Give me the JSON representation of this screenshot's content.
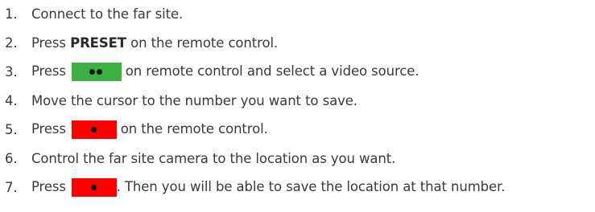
{
  "steps": [
    {
      "num": "1.",
      "text": "Connect to the far site."
    },
    {
      "num": "2.",
      "pre": "Press ",
      "bold": "PRESET",
      "post": " on the remote control."
    },
    {
      "num": "3.",
      "pre": "Press ",
      "post": " on remote control and select a video source."
    },
    {
      "num": "4.",
      "text": "Move the cursor to the number you want to save."
    },
    {
      "num": "5.",
      "pre": "Press ",
      "post": " on the remote control."
    },
    {
      "num": "6.",
      "text": "Control the far site camera to the location as you want."
    },
    {
      "num": "7.",
      "pre": "Press ",
      "post": ". Then you will be able to save the location at that number."
    }
  ],
  "keys": {
    "green": {
      "color": "#3cb043",
      "icon": "two-dots-icon"
    },
    "red": {
      "color": "#ff0000",
      "icon": "single-dot-icon"
    }
  }
}
